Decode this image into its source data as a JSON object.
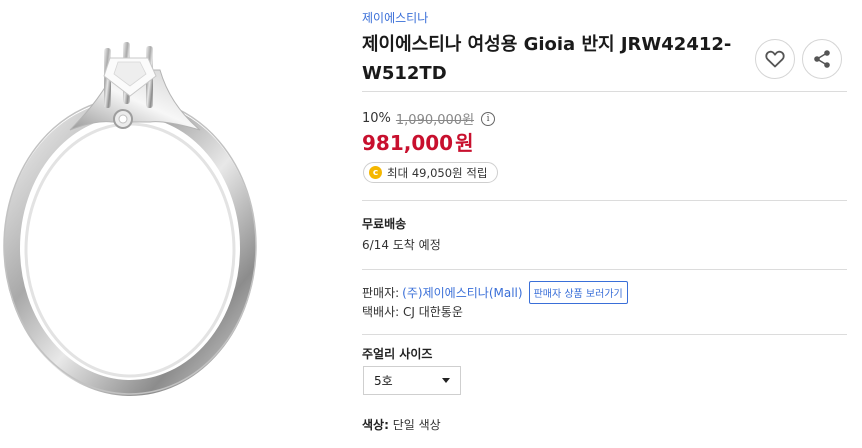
{
  "product": {
    "brand": "제이에스티나",
    "title": "제이에스티나 여성용 Gioia 반지 JRW42412-W512TD",
    "image_alt": "ring-product-image"
  },
  "price": {
    "discount": "10%",
    "original": "1,090,000원",
    "sale_amount": "981,000",
    "sale_unit": "원",
    "info_glyph": "i"
  },
  "points": {
    "coin_glyph": "c",
    "text": "최대 49,050원 적립"
  },
  "shipping": {
    "title": "무료배송",
    "date": "6/14 도착 예정"
  },
  "seller": {
    "label": "판매자:",
    "name": "(주)제이에스티나(Mall)",
    "button": "판매자 상품 보러가기",
    "courier": "택배사: CJ 대한통운"
  },
  "options": {
    "size_title": "주얼리 사이즈",
    "size_value": "5호",
    "color_label": "색상:",
    "color_value": "단일 색상"
  },
  "icons": {
    "like": "heart-icon",
    "share": "share-icon"
  },
  "colors": {
    "accent": "#3a6fd8",
    "sale": "#c8102e",
    "coin": "#f5b700"
  }
}
